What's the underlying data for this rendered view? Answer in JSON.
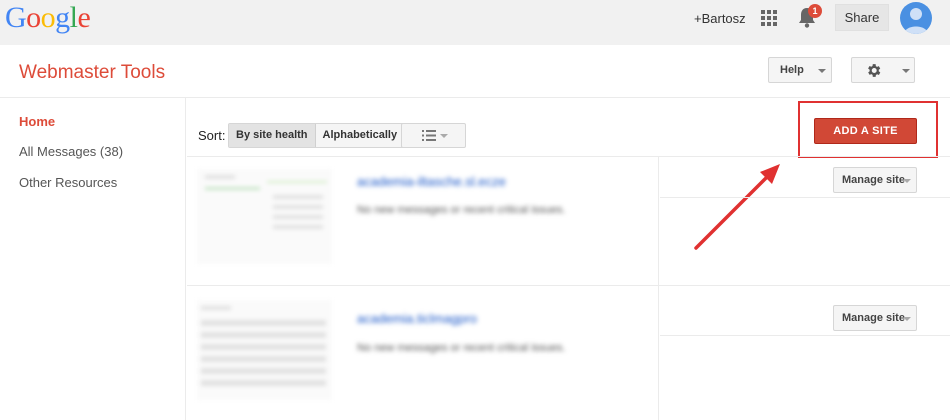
{
  "topbar": {
    "logo_letters": [
      {
        "ch": "G",
        "color": "#4285f4"
      },
      {
        "ch": "o",
        "color": "#ea4335"
      },
      {
        "ch": "o",
        "color": "#fbbc05"
      },
      {
        "ch": "g",
        "color": "#4285f4"
      },
      {
        "ch": "l",
        "color": "#34a853"
      },
      {
        "ch": "e",
        "color": "#ea4335"
      }
    ],
    "user_name": "+Bartosz",
    "notification_count": "1",
    "share_label": "Share",
    "icons": [
      "apps-grid-icon",
      "bell-icon",
      "avatar-icon"
    ]
  },
  "header": {
    "app_title": "Webmaster Tools",
    "help_label": "Help",
    "settings_icon": "gear-icon"
  },
  "sidebar": {
    "items": [
      {
        "label": "Home",
        "active": true
      },
      {
        "label": "All Messages (38)",
        "active": false
      },
      {
        "label": "Other Resources",
        "active": false
      }
    ]
  },
  "toolbar": {
    "sort_label": "Sort:",
    "sort_options": [
      "By site health",
      "Alphabetically"
    ],
    "sort_selected": "By site health",
    "view_icon": "list-view-icon",
    "add_site_label": "ADD A SITE"
  },
  "sites": [
    {
      "name": "academia-iltasche.sl.ecze",
      "message": "No new messages or recent critical issues.",
      "manage_label": "Manage site"
    },
    {
      "name": "academia.ticlmagpro",
      "message": "No new messages or recent critical issues.",
      "manage_label": "Manage site"
    }
  ],
  "colors": {
    "accent_red": "#dd4b39",
    "add_button": "#d14836",
    "link_blue": "#1a57c8",
    "annotation_red": "#e03131"
  }
}
